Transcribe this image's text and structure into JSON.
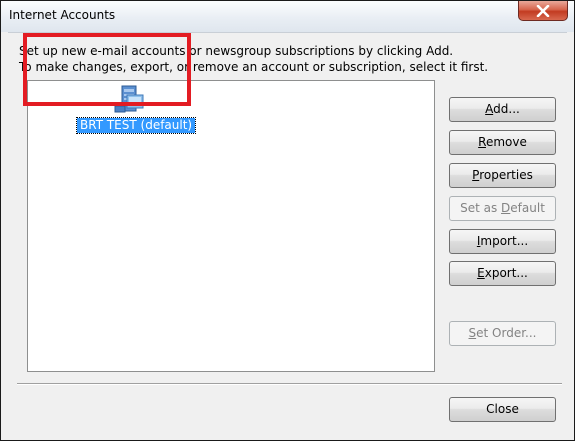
{
  "window": {
    "title": "Internet Accounts"
  },
  "instructions": {
    "line1": "Set up new e-mail accounts or newsgroup subscriptions by clicking Add.",
    "line2": "To make changes, export, or remove an account or subscription, select it first."
  },
  "accounts": [
    {
      "label": "BRT TEST (default)",
      "icon": "mail-server-icon",
      "selected": true
    }
  ],
  "buttons": {
    "add": {
      "pre": "",
      "key": "A",
      "post": "dd...",
      "enabled": true
    },
    "remove": {
      "pre": "",
      "key": "R",
      "post": "emove",
      "enabled": true
    },
    "properties": {
      "pre": "",
      "key": "P",
      "post": "roperties",
      "enabled": true
    },
    "set_default": {
      "pre": "Set as ",
      "key": "D",
      "post": "efault",
      "enabled": false
    },
    "import": {
      "pre": "",
      "key": "I",
      "post": "mport...",
      "enabled": true
    },
    "export": {
      "pre": "",
      "key": "E",
      "post": "xport...",
      "enabled": true
    },
    "set_order": {
      "pre": "",
      "key": "S",
      "post": "et Order...",
      "enabled": false
    },
    "close": {
      "pre": "",
      "key": "",
      "post": "Close",
      "enabled": true
    }
  },
  "colors": {
    "selection": "#3399ff",
    "highlight_box": "#e31c23",
    "close_button": "#c23b21"
  }
}
